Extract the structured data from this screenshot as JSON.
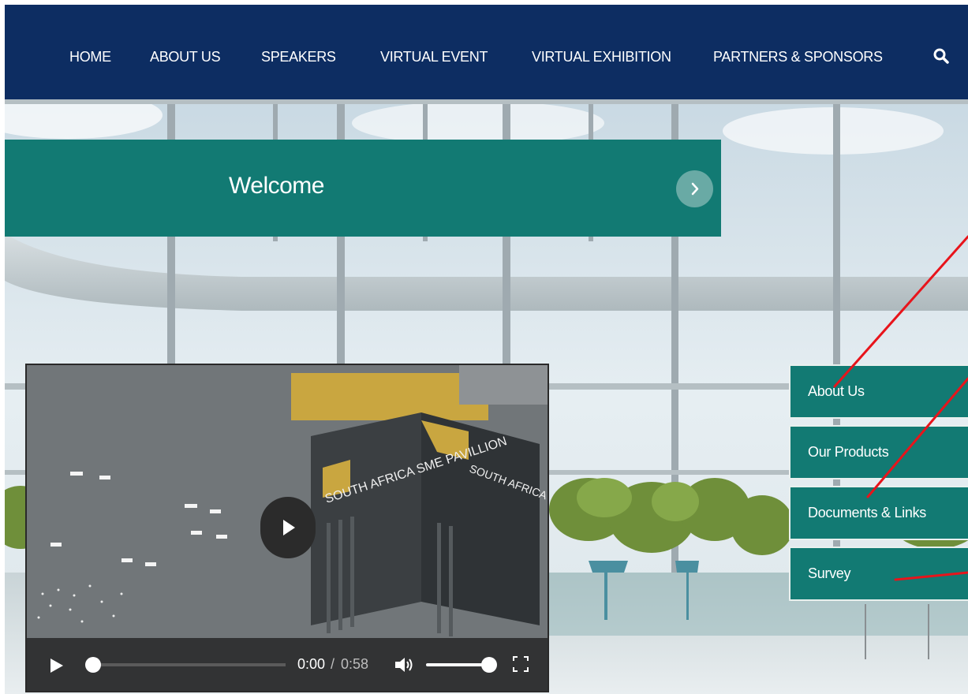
{
  "nav": {
    "items": [
      "HOME",
      "ABOUT US",
      "SPEAKERS",
      "VIRTUAL EVENT",
      "VIRTUAL EXHIBITION",
      "PARTNERS & SPONSORS"
    ],
    "search_icon": "search-icon"
  },
  "welcome": {
    "title": "Welcome",
    "arrow_icon": "chevron-right-icon"
  },
  "video": {
    "sign_left": "SOUTH AFRICA SME PAVILLION",
    "sign_right": "SOUTH AFRICA SME PAVILLION",
    "current_time": "0:00",
    "separator": "/",
    "total_time": "0:58",
    "progress": 0,
    "volume": 1.0,
    "icons": [
      "play-icon",
      "volume-icon",
      "fullscreen-icon"
    ]
  },
  "side_menu": {
    "items": [
      "About Us",
      "Our Products",
      "Documents & Links",
      "Survey"
    ]
  },
  "colors": {
    "nav_bg": "#0d2d62",
    "teal": "#127a73",
    "annotation": "#e8141b"
  }
}
